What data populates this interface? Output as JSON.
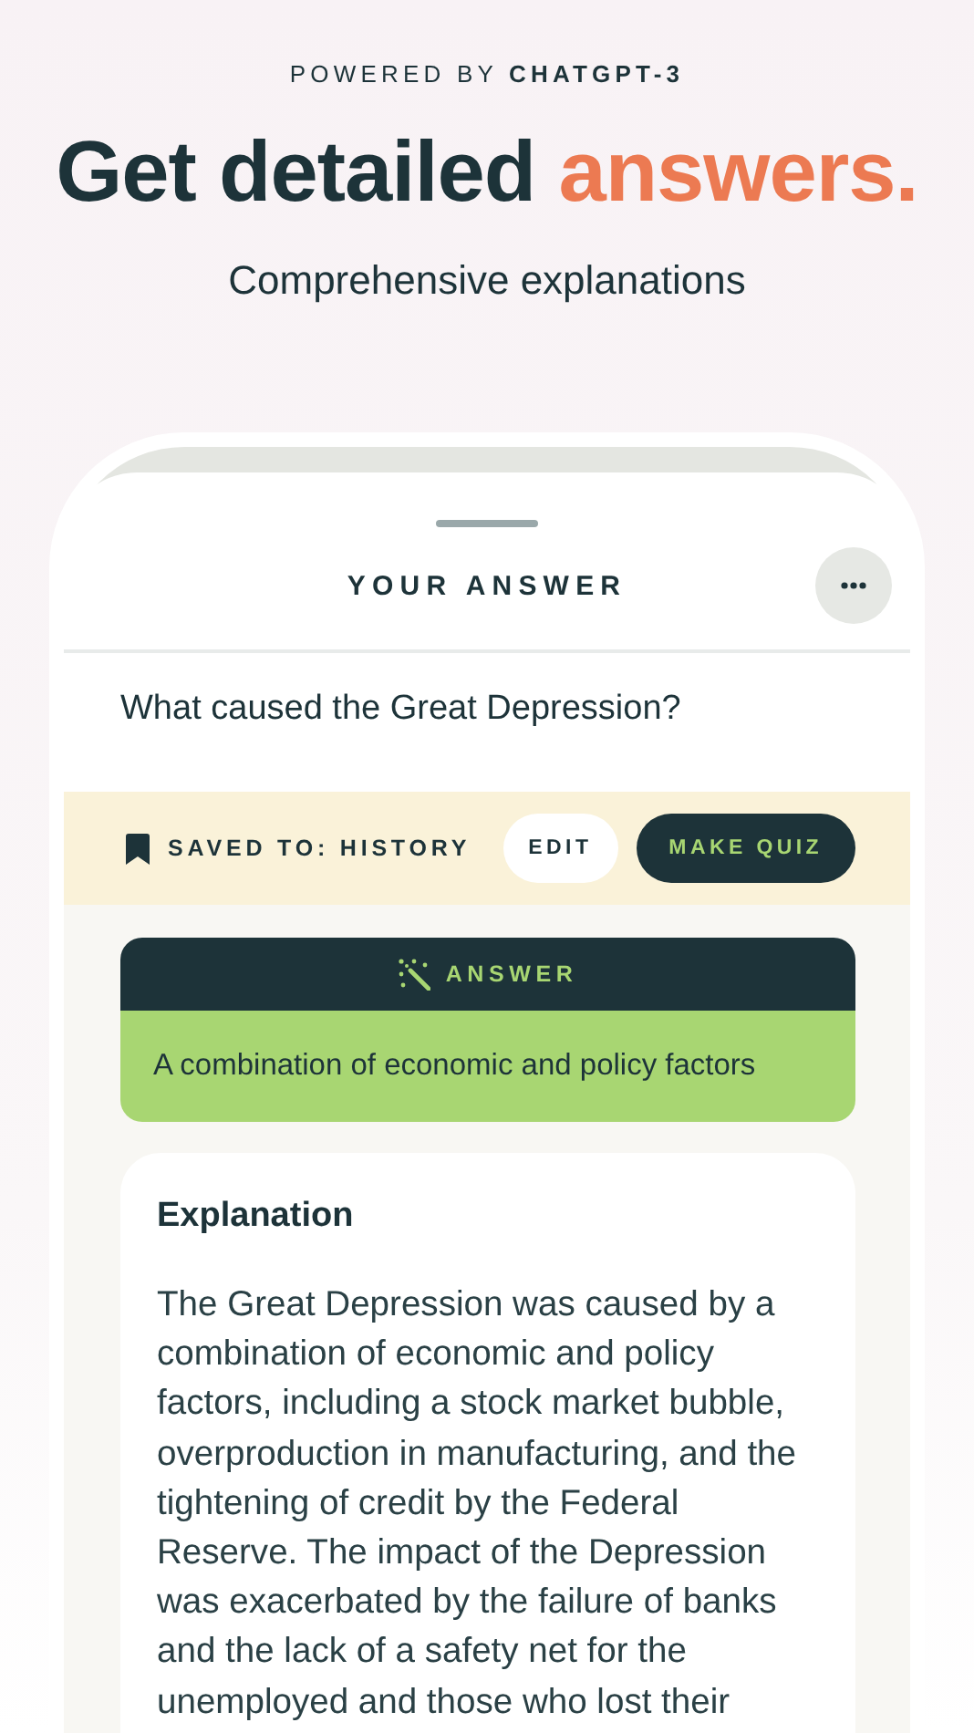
{
  "header": {
    "powered_by": "POWERED BY",
    "brand": "CHATGPT-3",
    "headline": "Get detailed",
    "headline_accent": "answers.",
    "subtitle": "Comprehensive explanations"
  },
  "sheet": {
    "title": "YOUR ANSWER",
    "question": "What caused the Great Depression?",
    "saved": {
      "label": "SAVED TO:",
      "folder": "HISTORY"
    },
    "buttons": [
      {
        "label": "EDIT",
        "kind": "secondary"
      },
      {
        "label": "MAKE QUIZ",
        "kind": "primary"
      }
    ],
    "answer": {
      "label": "ANSWER",
      "text": "A combination of economic and policy factors"
    },
    "explanation": {
      "title": "Explanation",
      "text": "The Great Depression was caused by a combination of economic and policy factors, including a stock market bubble, overproduction in manufacturing, and the tightening of credit by the Federal Reserve. The impact of the Depression was exacerbated by the failure of banks and the lack of a safety net for the unemployed and those who lost their"
    }
  }
}
